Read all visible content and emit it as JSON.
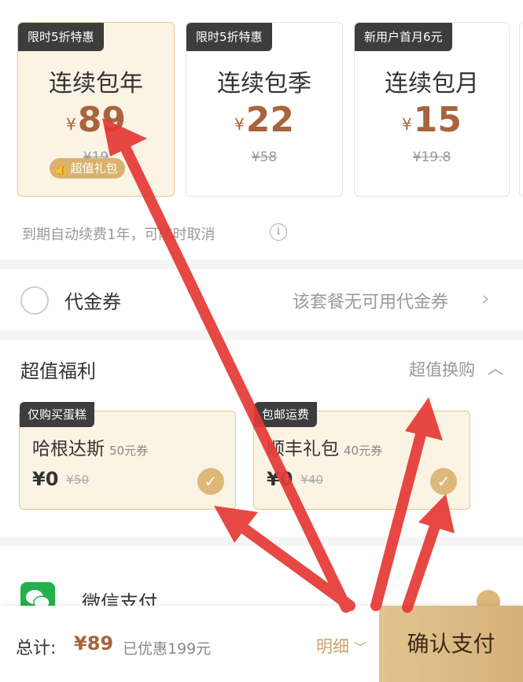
{
  "plans": [
    {
      "tag": "限时5折特惠",
      "title": "连续包年",
      "currency": "¥",
      "price": "89",
      "original": "¥19",
      "badge": "超值礼包",
      "selected": true
    },
    {
      "tag": "限时5折特惠",
      "title": "连续包季",
      "currency": "¥",
      "price": "22",
      "original": "¥58",
      "selected": false
    },
    {
      "tag": "新用户首月6元",
      "title": "连续包月",
      "currency": "¥",
      "price": "15",
      "original": "¥19.8",
      "selected": false
    }
  ],
  "renew_note": "到期自动续费1年，可随时取消",
  "voucher": {
    "label": "代金券",
    "note": "该套餐无可用代金券"
  },
  "benefits": {
    "title": "超值福利",
    "link": "超值换购",
    "items": [
      {
        "tag": "仅购买蛋糕",
        "name": "哈根达斯",
        "sub": "50元券",
        "price": "¥0",
        "original": "¥50"
      },
      {
        "tag": "包邮运费",
        "name": "顺丰礼包",
        "sub": "40元券",
        "price": "¥0",
        "original": "¥40"
      }
    ]
  },
  "payment": {
    "label": "微信支付"
  },
  "footer": {
    "total_label": "总计:",
    "total_amount": "¥89",
    "saved": "已优惠199元",
    "detail": "明细",
    "pay_button": "确认支付"
  },
  "icons": [
    "thumb-up-icon",
    "info-icon",
    "chevron-right-icon",
    "chevron-up-icon",
    "check-icon",
    "chevron-down-icon",
    "wechat-icon"
  ],
  "colors": {
    "accent": "#a8643d",
    "gold": "#dcb978",
    "tag_bg": "#3d3d3d",
    "arrow": "#e53935"
  }
}
